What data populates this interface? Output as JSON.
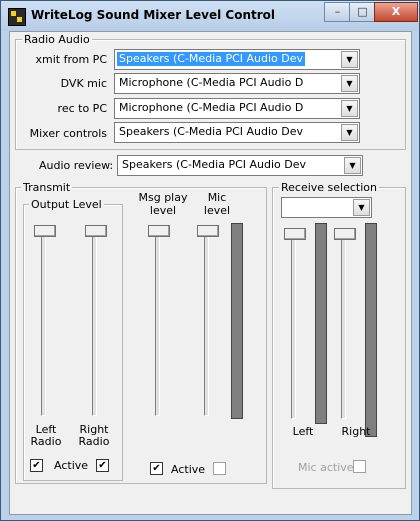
{
  "window": {
    "title": "WriteLog Sound Mixer Level Control",
    "buttons": {
      "minimize": "–",
      "maximize": "□",
      "close": "X"
    }
  },
  "radio_audio": {
    "title": "Radio Audio",
    "rows": [
      {
        "label": "xmit from PC",
        "value": "Speakers (C-Media PCI Audio Dev"
      },
      {
        "label": "DVK mic",
        "value": "Microphone (C-Media PCI Audio D"
      },
      {
        "label": "rec to PC",
        "value": "Microphone (C-Media PCI Audio D"
      },
      {
        "label": "Mixer controls",
        "value": "Speakers (C-Media PCI Audio Dev"
      }
    ]
  },
  "audio_review": {
    "label": "Audio review:",
    "value": "Speakers (C-Media PCI Audio Dev"
  },
  "transmit": {
    "title": "Transmit",
    "output_level": {
      "title": "Output Level",
      "left_label_1": "Left",
      "left_label_2": "Radio",
      "right_label_1": "Right",
      "right_label_2": "Radio",
      "active_label": "Active",
      "left_checked": true,
      "right_checked": true,
      "left_level": 1.0,
      "right_level": 1.0
    },
    "msg_play": {
      "label_1": "Msg play",
      "label_2": "level",
      "level": 1.0
    },
    "mic": {
      "label_1": "Mic",
      "label_2": "level",
      "level": 1.0
    },
    "active_label": "Active",
    "msg_active_checked": true,
    "mic_active_checked": false
  },
  "receive": {
    "title": "Receive selection",
    "select_value": "",
    "left_label": "Left",
    "right_label": "Right",
    "left_level": 1.0,
    "right_level": 1.0,
    "mic_active_label": "Mic active",
    "mic_active_checked": false
  },
  "icons": {
    "dropdown": "▼",
    "check": "✔"
  }
}
